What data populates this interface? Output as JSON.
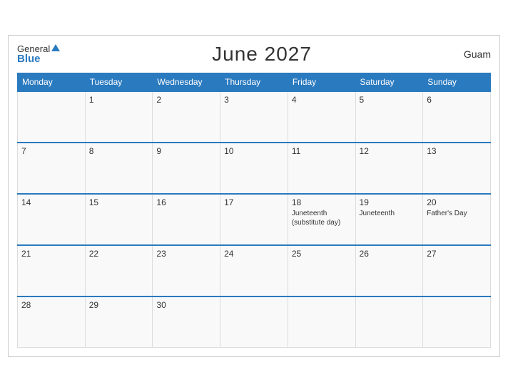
{
  "header": {
    "logo_general": "General",
    "logo_blue": "Blue",
    "title": "June 2027",
    "region": "Guam"
  },
  "columns": [
    "Monday",
    "Tuesday",
    "Wednesday",
    "Thursday",
    "Friday",
    "Saturday",
    "Sunday"
  ],
  "weeks": [
    [
      {
        "day": "",
        "events": []
      },
      {
        "day": "1",
        "events": []
      },
      {
        "day": "2",
        "events": []
      },
      {
        "day": "3",
        "events": []
      },
      {
        "day": "4",
        "events": []
      },
      {
        "day": "5",
        "events": []
      },
      {
        "day": "6",
        "events": []
      }
    ],
    [
      {
        "day": "7",
        "events": []
      },
      {
        "day": "8",
        "events": []
      },
      {
        "day": "9",
        "events": []
      },
      {
        "day": "10",
        "events": []
      },
      {
        "day": "11",
        "events": []
      },
      {
        "day": "12",
        "events": []
      },
      {
        "day": "13",
        "events": []
      }
    ],
    [
      {
        "day": "14",
        "events": []
      },
      {
        "day": "15",
        "events": []
      },
      {
        "day": "16",
        "events": []
      },
      {
        "day": "17",
        "events": []
      },
      {
        "day": "18",
        "events": [
          "Juneteenth",
          "(substitute day)"
        ]
      },
      {
        "day": "19",
        "events": [
          "Juneteenth"
        ]
      },
      {
        "day": "20",
        "events": [
          "Father's Day"
        ]
      }
    ],
    [
      {
        "day": "21",
        "events": []
      },
      {
        "day": "22",
        "events": []
      },
      {
        "day": "23",
        "events": []
      },
      {
        "day": "24",
        "events": []
      },
      {
        "day": "25",
        "events": []
      },
      {
        "day": "26",
        "events": []
      },
      {
        "day": "27",
        "events": []
      }
    ],
    [
      {
        "day": "28",
        "events": []
      },
      {
        "day": "29",
        "events": []
      },
      {
        "day": "30",
        "events": []
      },
      {
        "day": "",
        "events": []
      },
      {
        "day": "",
        "events": []
      },
      {
        "day": "",
        "events": []
      },
      {
        "day": "",
        "events": []
      }
    ]
  ]
}
